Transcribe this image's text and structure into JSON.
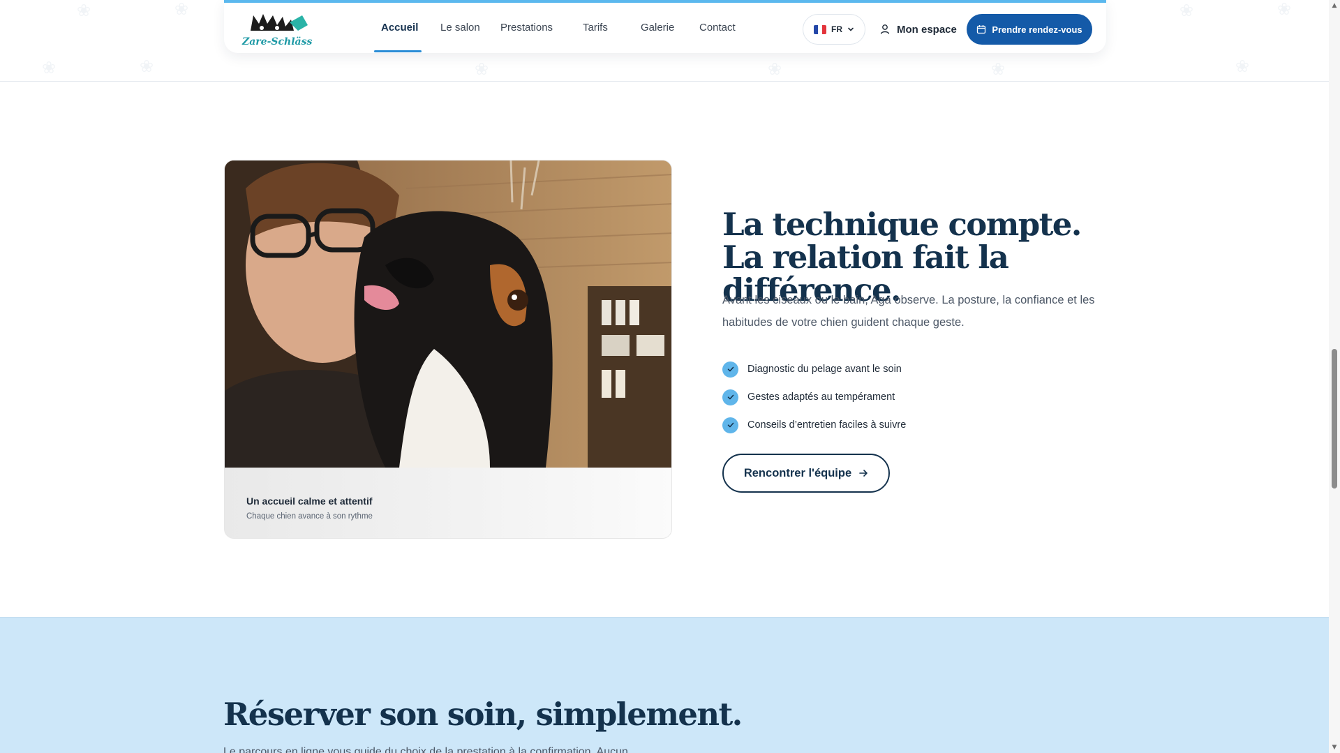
{
  "header": {
    "logo_text": "Zare-Schläss",
    "nav": [
      {
        "label": "Accueil",
        "active": true
      },
      {
        "label": "Le salon"
      },
      {
        "label": "Prestations"
      },
      {
        "label": "Tarifs"
      },
      {
        "label": "Galerie"
      },
      {
        "label": "Contact"
      }
    ],
    "language": {
      "code": "FR",
      "icon": "chevron-down-icon"
    },
    "account_label": "Mon espace",
    "cta_label": "Prendre rendez-vous",
    "accent_color": "#145aa8"
  },
  "feature": {
    "photo_caption_title": "Un accueil calme et attentif",
    "photo_caption_subtitle": "Chaque chien avance à son rythme",
    "headline": "La technique compte. La relation fait la différence.",
    "lead": "Avant les ciseaux ou le bain, Aga observe. La posture, la confiance et les habitudes de votre chien guident chaque geste.",
    "checks": [
      "Diagnostic du pelage avant le soin",
      "Gestes adaptés au tempérament",
      "Conseils d’entretien faciles à suivre"
    ],
    "button_label": "Rencontrer l'équipe",
    "check_color": "#5fb5ea"
  },
  "booking": {
    "title": "Réserver son soin, simplement.",
    "text": "Le parcours en ligne vous guide du choix de la prestation à la confirmation. Aucun",
    "background_color": "#cde7f9"
  }
}
